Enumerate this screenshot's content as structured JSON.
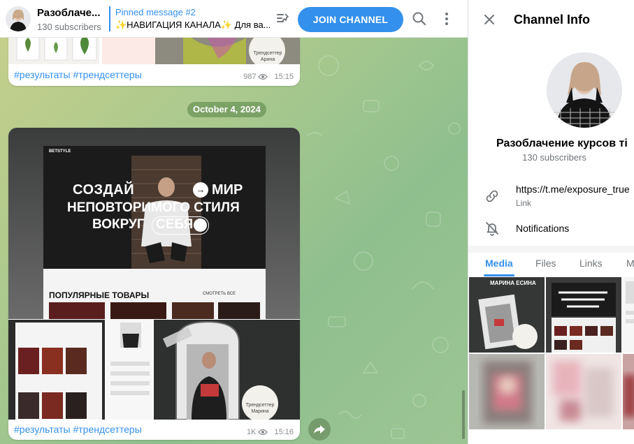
{
  "header": {
    "channel_title": "Разоблаче...",
    "subscribers": "130 subscribers",
    "pinned_title": "Pinned message #2",
    "pinned_text": "✨НАВИГАЦИЯ КАНАЛА✨ Для ва...",
    "join_label": "JOIN CHANNEL",
    "icons": [
      "pinned-list-icon",
      "search-icon",
      "more-vertical-icon"
    ]
  },
  "chat": {
    "messages": [
      {
        "text": "#результаты #трендсеттеры",
        "views": "987",
        "time": "15:15",
        "image_caption": "Трендсеттер Арина"
      },
      {
        "text": "#результаты #трендсеттеры",
        "views": "1K",
        "time": "15:16",
        "image_caption": "Трендсеттер Марина",
        "hero_line1": "СОЗДАЙ",
        "hero_line1b": "МИР",
        "hero_line2": "НЕПОВТОРИМОГО СТИЛЯ",
        "hero_line3": "ВОКРУГ",
        "hero_line3b": "СЕБЯ",
        "popular_title": "ПОПУЛЯРНЫЕ ТОВАРЫ",
        "see_all": "СМОТРЕТЬ ВСЕ",
        "brand": "BETSTYLE"
      }
    ],
    "date_badge": "October 4, 2024"
  },
  "panel": {
    "title": "Channel Info",
    "name": "Разоблачение курсов ті",
    "subscribers": "130 subscribers",
    "link_value": "https://t.me/exposure_true",
    "link_label": "Link",
    "notifications_label": "Notifications",
    "tabs": [
      "Media",
      "Files",
      "Links",
      "M"
    ],
    "active_tab": "Media",
    "media_caption": "МАРИНА ЕСИНА"
  },
  "colors": {
    "accent": "#3390ec",
    "chat_bg": "#a9c98e",
    "meta": "#8a8d90"
  }
}
